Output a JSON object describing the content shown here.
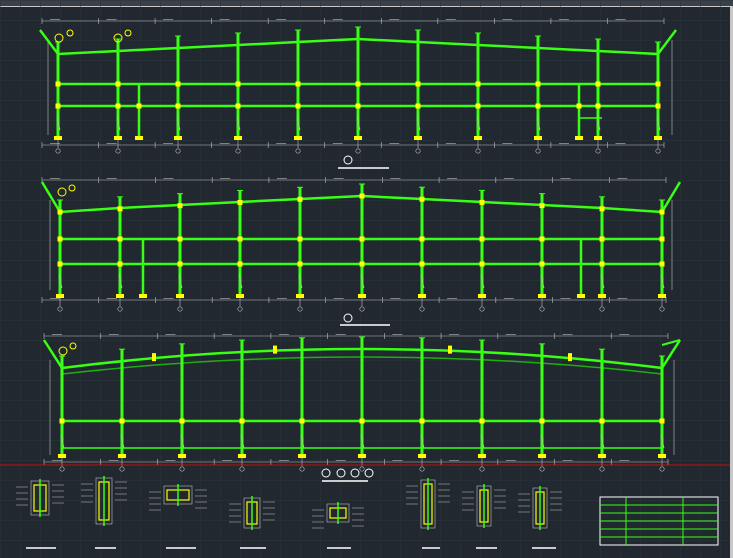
{
  "drawing": {
    "section_marks": [
      "①",
      "②",
      "③"
    ],
    "detail_callouts": [
      "④",
      "⑤",
      "⑥",
      "⑦"
    ],
    "colors": {
      "background": "#212830",
      "grid": "#2b333c",
      "frame": "#39ff14",
      "frame_dark": "#1fae12",
      "dim": "#bfbfbf",
      "node": "#ffff00",
      "separator": "#ff0000",
      "text": "#ffffff"
    }
  },
  "schedule_table": {
    "rows": 6,
    "columns": 3
  }
}
